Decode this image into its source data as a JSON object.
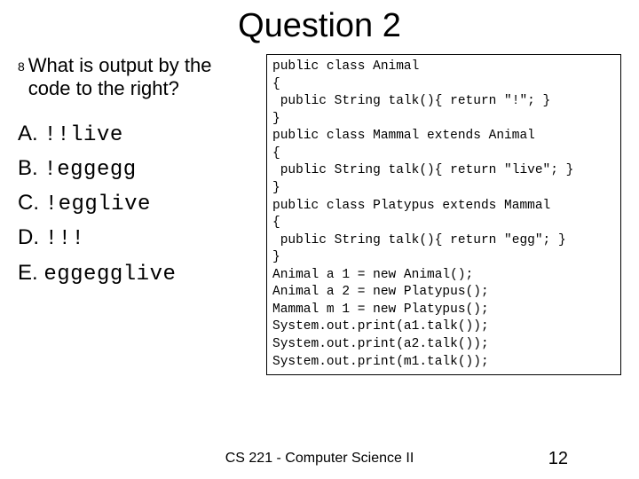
{
  "title": "Question 2",
  "question": {
    "bullet": "8",
    "text": "What is output by the code to the right?"
  },
  "options": [
    {
      "label": "A. ",
      "code": "!!live"
    },
    {
      "label": "B. ",
      "code": "!eggegg"
    },
    {
      "label": "C. ",
      "code": "!egglive"
    },
    {
      "label": "D. ",
      "code": "!!!"
    },
    {
      "label": "E. ",
      "code": "eggegglive"
    }
  ],
  "code": "public class Animal\n{\n public String talk(){ return \"!\"; }\n}\npublic class Mammal extends Animal\n{\n public String talk(){ return \"live\"; }\n}\npublic class Platypus extends Mammal\n{\n public String talk(){ return \"egg\"; }\n}\nAnimal a 1 = new Animal();\nAnimal a 2 = new Platypus();\nMammal m 1 = new Platypus();\nSystem.out.print(a1.talk());\nSystem.out.print(a2.talk());\nSystem.out.print(m1.talk());",
  "footer": {
    "course": "CS 221 - Computer Science II",
    "page": "12"
  }
}
